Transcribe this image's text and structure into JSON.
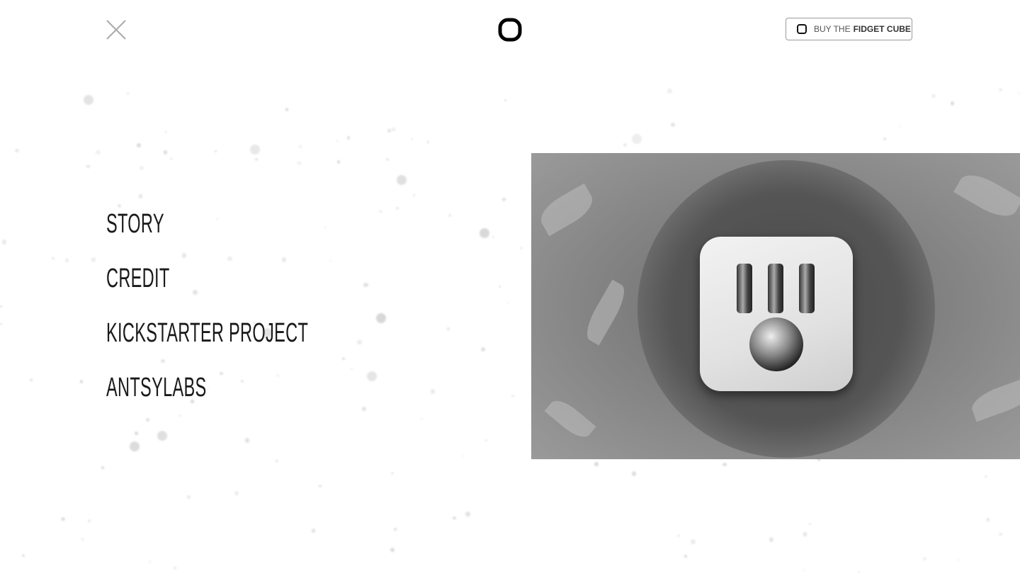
{
  "header": {
    "close_icon": "close-x-icon",
    "logo_icon": "rounded-square-logo",
    "buy_button": {
      "prefix": "BUY THE",
      "bold": "FIDGET CUBE",
      "icon": "rounded-square-icon"
    }
  },
  "menu": {
    "items": [
      {
        "label": "STORY"
      },
      {
        "label": "CREDIT"
      },
      {
        "label": "KICKSTARTER PROJECT"
      },
      {
        "label": "ANTSYLABS"
      }
    ]
  },
  "hero_image": {
    "subject": "fidget-cube-photo",
    "tone": "grayscale"
  }
}
